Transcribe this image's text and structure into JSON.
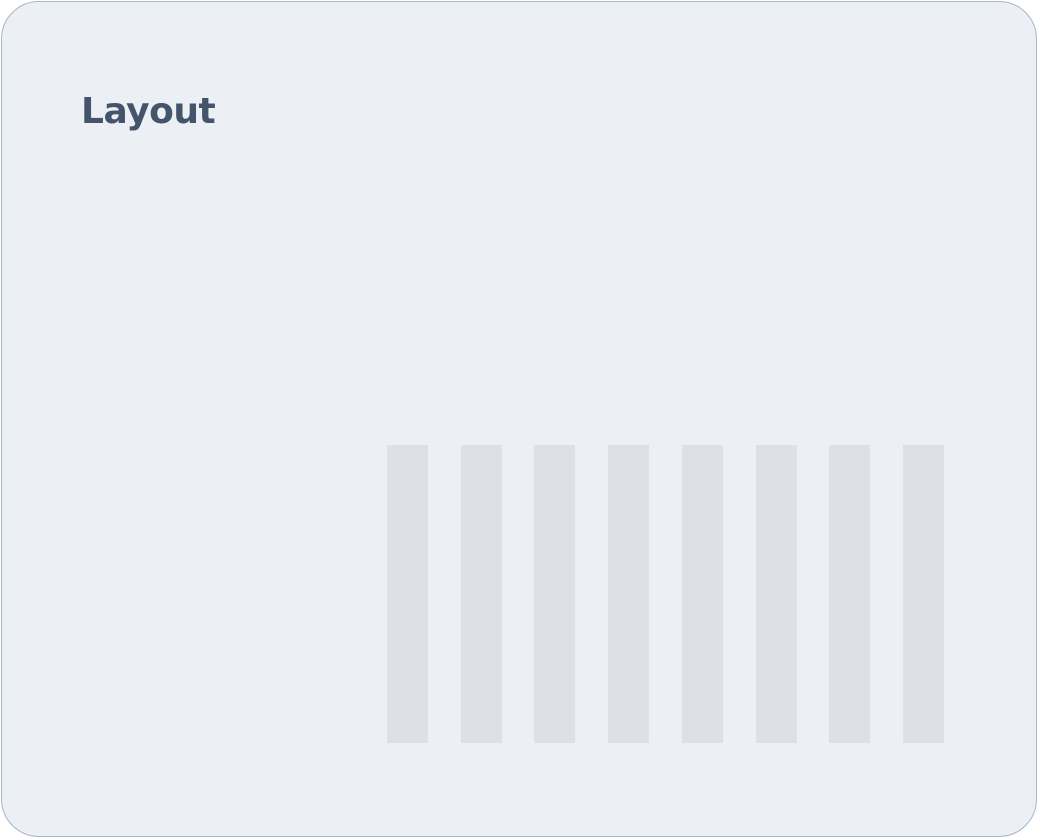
{
  "panel": {
    "title": "Layout",
    "column_count": 8
  },
  "colors": {
    "background": "#ecf0f5",
    "border": "#a3b6cc",
    "title": "#44546a",
    "column": "#dde1e6"
  }
}
